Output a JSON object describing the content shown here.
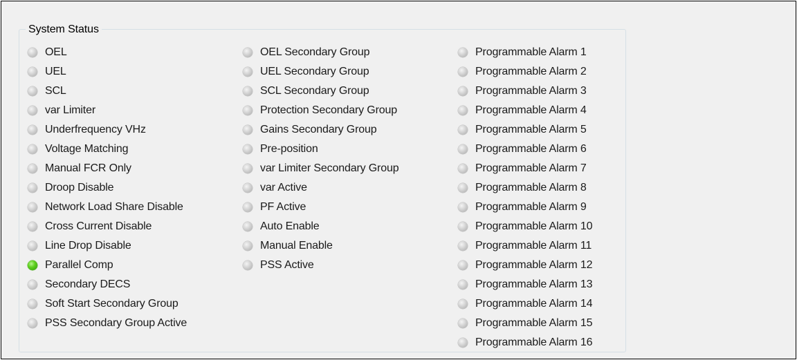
{
  "panel": {
    "title": "System Status",
    "colors": {
      "indicator_off": "#c8c8c8",
      "indicator_on": "#4cc418"
    },
    "columns": [
      [
        {
          "label": "OEL",
          "state": "off"
        },
        {
          "label": "UEL",
          "state": "off"
        },
        {
          "label": "SCL",
          "state": "off"
        },
        {
          "label": "var Limiter",
          "state": "off"
        },
        {
          "label": "Underfrequency VHz",
          "state": "off"
        },
        {
          "label": "Voltage Matching",
          "state": "off"
        },
        {
          "label": "Manual FCR Only",
          "state": "off"
        },
        {
          "label": "Droop Disable",
          "state": "off"
        },
        {
          "label": "Network Load Share Disable",
          "state": "off"
        },
        {
          "label": "Cross Current Disable",
          "state": "off"
        },
        {
          "label": "Line Drop Disable",
          "state": "off"
        },
        {
          "label": "Parallel Comp",
          "state": "on"
        },
        {
          "label": "Secondary DECS",
          "state": "off"
        },
        {
          "label": "Soft Start Secondary Group",
          "state": "off"
        },
        {
          "label": "PSS Secondary Group Active",
          "state": "off"
        }
      ],
      [
        {
          "label": "OEL Secondary Group",
          "state": "off"
        },
        {
          "label": "UEL Secondary Group",
          "state": "off"
        },
        {
          "label": "SCL Secondary Group",
          "state": "off"
        },
        {
          "label": "Protection Secondary Group",
          "state": "off"
        },
        {
          "label": "Gains Secondary Group",
          "state": "off"
        },
        {
          "label": "Pre-position",
          "state": "off"
        },
        {
          "label": "var Limiter Secondary Group",
          "state": "off"
        },
        {
          "label": "var Active",
          "state": "off"
        },
        {
          "label": "PF Active",
          "state": "off"
        },
        {
          "label": "Auto Enable",
          "state": "off"
        },
        {
          "label": "Manual Enable",
          "state": "off"
        },
        {
          "label": "PSS Active",
          "state": "off"
        }
      ],
      [
        {
          "label": "Programmable Alarm 1",
          "state": "off"
        },
        {
          "label": "Programmable Alarm 2",
          "state": "off"
        },
        {
          "label": "Programmable Alarm 3",
          "state": "off"
        },
        {
          "label": "Programmable Alarm 4",
          "state": "off"
        },
        {
          "label": "Programmable Alarm 5",
          "state": "off"
        },
        {
          "label": "Programmable Alarm 6",
          "state": "off"
        },
        {
          "label": "Programmable Alarm 7",
          "state": "off"
        },
        {
          "label": "Programmable Alarm 8",
          "state": "off"
        },
        {
          "label": "Programmable Alarm 9",
          "state": "off"
        },
        {
          "label": "Programmable Alarm 10",
          "state": "off"
        },
        {
          "label": "Programmable Alarm 11",
          "state": "off"
        },
        {
          "label": "Programmable Alarm 12",
          "state": "off"
        },
        {
          "label": "Programmable Alarm 13",
          "state": "off"
        },
        {
          "label": "Programmable Alarm 14",
          "state": "off"
        },
        {
          "label": "Programmable Alarm 15",
          "state": "off"
        },
        {
          "label": "Programmable Alarm 16",
          "state": "off"
        }
      ]
    ]
  }
}
